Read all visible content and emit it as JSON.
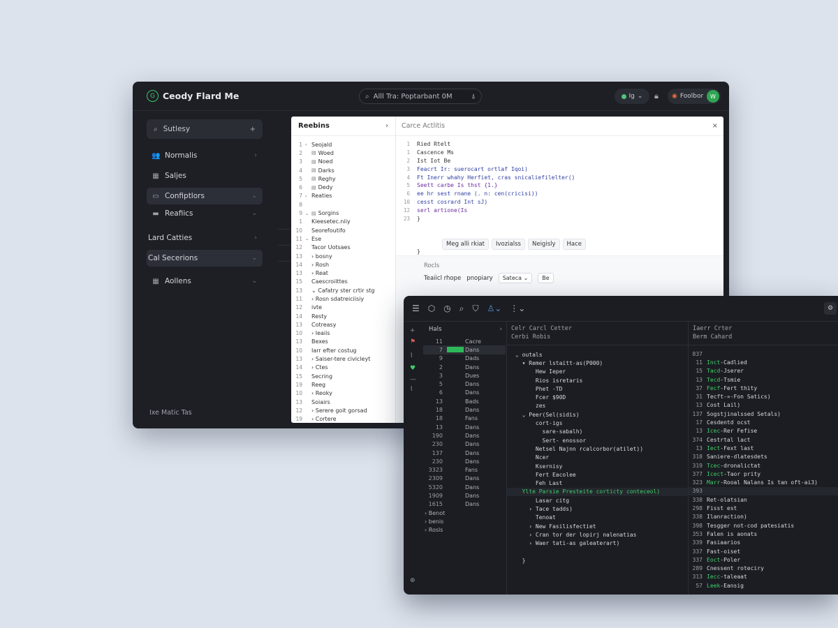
{
  "win1": {
    "brand": {
      "logo": "G",
      "name": "Ceody Flard Me"
    },
    "search": {
      "text": "Alll Tra: Poptarbant 0M"
    },
    "lang_label": "Ig",
    "user_name": "Foolbor",
    "user_avatar": "W",
    "sidebar": {
      "search_text": "Sutlesy",
      "items": [
        {
          "label": "Normalis",
          "icon": "users-icon",
          "glyph": "👥",
          "chev": "›",
          "active": false
        },
        {
          "label": "Saljes",
          "icon": "grid-icon",
          "glyph": "▦",
          "chev": "",
          "active": false
        },
        {
          "label": "Confiptlors",
          "icon": "folder-icon",
          "glyph": "▭",
          "chev": "⌄",
          "active": true
        },
        {
          "label": "Reafiics",
          "icon": "folder-icon",
          "glyph": "▬",
          "chev": "⌄",
          "active": false
        },
        {
          "label": "Lard Catties",
          "icon": "",
          "glyph": "",
          "chev": "›",
          "active": false
        },
        {
          "label": "Cal Secerions",
          "icon": "",
          "glyph": "",
          "chev": "⌄",
          "active": true
        },
        {
          "label": "Aollens",
          "icon": "grid-icon",
          "glyph": "▦",
          "chev": "⌄",
          "active": false
        }
      ],
      "footer": "Ixe Matic Tas"
    },
    "tree": {
      "title": "Reebins",
      "rows": [
        {
          "ln": "1",
          "arr": "›",
          "icon": "",
          "t": "Seojald"
        },
        {
          "ln": "2",
          "arr": "",
          "icon": "▤",
          "t": "Woed"
        },
        {
          "ln": "3",
          "arr": "",
          "icon": "▤",
          "t": "Noed"
        },
        {
          "ln": "4",
          "arr": "",
          "icon": "▤",
          "t": "Darks"
        },
        {
          "ln": "5",
          "arr": "",
          "icon": "▤",
          "t": "Reghy"
        },
        {
          "ln": "6",
          "arr": "",
          "icon": "▤",
          "t": "Dedy"
        },
        {
          "ln": "7",
          "arr": "›",
          "icon": "",
          "t": "Reaties"
        },
        {
          "ln": "8",
          "arr": "",
          "icon": "",
          "t": ""
        },
        {
          "ln": "9",
          "arr": "⌄",
          "icon": "▤",
          "t": "Sorgins"
        },
        {
          "ln": "1",
          "arr": "",
          "icon": "",
          "t": "Kieesetec.niiy"
        },
        {
          "ln": "10",
          "arr": "",
          "icon": "",
          "t": "Seorefoutifo"
        },
        {
          "ln": "11",
          "arr": "⌄",
          "icon": "",
          "t": "Ese"
        },
        {
          "ln": "12",
          "arr": "",
          "icon": "",
          "t": "Tacor Uotsaes"
        },
        {
          "ln": "13",
          "arr": "",
          "icon": "",
          "t": "› bosny"
        },
        {
          "ln": "14",
          "arr": "",
          "icon": "",
          "t": "› Rosh"
        },
        {
          "ln": "13",
          "arr": "",
          "icon": "",
          "t": "› Reat"
        },
        {
          "ln": "15",
          "arr": "",
          "icon": "",
          "t": "Caescroiittes"
        },
        {
          "ln": "13",
          "arr": "",
          "icon": "",
          "t": "⌄ Cafatry ster crtir stg"
        },
        {
          "ln": "11",
          "arr": "",
          "icon": "",
          "t": "› Rosn sdatreiciisiy"
        },
        {
          "ln": "12",
          "arr": "",
          "icon": "",
          "t": "ivte"
        },
        {
          "ln": "14",
          "arr": "",
          "icon": "",
          "t": "Resty"
        },
        {
          "ln": "13",
          "arr": "",
          "icon": "",
          "t": "Cotreasy"
        },
        {
          "ln": "10",
          "arr": "",
          "icon": "",
          "t": "› Ieaiis"
        },
        {
          "ln": "13",
          "arr": "",
          "icon": "",
          "t": "Bexes"
        },
        {
          "ln": "10",
          "arr": "",
          "icon": "",
          "t": "Iarr efter costug"
        },
        {
          "ln": "13",
          "arr": "",
          "icon": "",
          "t": "› Saiser-tere civicleyt"
        },
        {
          "ln": "14",
          "arr": "",
          "icon": "",
          "t": "› Ctes"
        },
        {
          "ln": "15",
          "arr": "",
          "icon": "",
          "t": "Secring"
        },
        {
          "ln": "19",
          "arr": "",
          "icon": "",
          "t": "Reeg"
        },
        {
          "ln": "10",
          "arr": "",
          "icon": "",
          "t": "› Reoky"
        },
        {
          "ln": "13",
          "arr": "",
          "icon": "",
          "t": "Soiairs"
        },
        {
          "ln": "12",
          "arr": "",
          "icon": "",
          "t": "› Serere goit gorsad"
        },
        {
          "ln": "19",
          "arr": "",
          "icon": "",
          "t": "› Cortere"
        },
        {
          "ln": "15",
          "arr": "",
          "icon": "",
          "t": "› Cetienrs"
        }
      ]
    },
    "editor": {
      "title": "Carce Actlitis",
      "code": [
        {
          "ln": "1",
          "t": "Ried Rtelt"
        },
        {
          "ln": "1",
          "t": "Cascence Ms"
        },
        {
          "ln": "2",
          "t": "Ist Iot Be"
        },
        {
          "ln": "3",
          "t": "Feacrt Ir: suerocart ortlaf Iqoi)"
        },
        {
          "ln": "4",
          "t": "Ft  Inerr whahy Herfiet, cras snicaliefilelter()"
        },
        {
          "ln": "5",
          "t": "  Seett carbe Is thst {1.}"
        },
        {
          "ln": "6",
          "t": "    ee hr sest rnane (. n: cen(cricisi))"
        },
        {
          "ln": "10",
          "t": "    cesst cosrard Int sJ)"
        },
        {
          "ln": "12",
          "t": "    serl artione(Is"
        },
        {
          "ln": "23",
          "t": "  }"
        },
        {
          "ln": "",
          "t": ""
        },
        {
          "ln": "",
          "t": ""
        },
        {
          "ln": "",
          "t": ""
        },
        {
          "ln": "",
          "t": "}"
        }
      ],
      "chips": [
        "Meg alli rkiat",
        "Ivozialss",
        "Neigisly",
        "Hace"
      ],
      "bottom_label": "Rocls",
      "bottom_text1": "Teaiicl rhope",
      "bottom_text2": "pnopiary",
      "bottom_select": "Sateca ⌄",
      "bottom_extra": "Be",
      "close": "×"
    }
  },
  "win2": {
    "list": {
      "title": "Hals",
      "rows": [
        {
          "n": "11",
          "bar": false,
          "v": "Cacre",
          "sel": false
        },
        {
          "n": "7",
          "bar": true,
          "v": "Dans",
          "sel": true
        },
        {
          "n": "9",
          "bar": false,
          "v": "Dads",
          "sel": false
        },
        {
          "n": "2",
          "bar": false,
          "v": "Dans",
          "sel": false
        },
        {
          "n": "3",
          "bar": false,
          "v": "Dues",
          "sel": false
        },
        {
          "n": "5",
          "bar": false,
          "v": "Dans",
          "sel": false
        },
        {
          "n": "6",
          "bar": false,
          "v": "Dans",
          "sel": false
        },
        {
          "n": "13",
          "bar": false,
          "v": "Bads",
          "sel": false
        },
        {
          "n": "18",
          "bar": false,
          "v": "Dans",
          "sel": false
        },
        {
          "n": "18",
          "bar": false,
          "v": "Fans",
          "sel": false
        },
        {
          "n": "13",
          "bar": false,
          "v": "Dans",
          "sel": false
        },
        {
          "n": "190",
          "bar": false,
          "v": "Dans",
          "sel": false
        },
        {
          "n": "230",
          "bar": false,
          "v": "Dans",
          "sel": false
        },
        {
          "n": "137",
          "bar": false,
          "v": "Dans",
          "sel": false
        },
        {
          "n": "230",
          "bar": false,
          "v": "Dans",
          "sel": false
        },
        {
          "n": "3323",
          "bar": false,
          "v": "Fans",
          "sel": false
        },
        {
          "n": "2309",
          "bar": false,
          "v": "Dans",
          "sel": false
        },
        {
          "n": "5320",
          "bar": false,
          "v": "Dans",
          "sel": false
        },
        {
          "n": "1909",
          "bar": false,
          "v": "Dans",
          "sel": false
        },
        {
          "n": "1615",
          "bar": false,
          "v": "Dans",
          "sel": false
        }
      ],
      "tree": [
        "› Benot",
        "› benis",
        "› Rosls"
      ]
    },
    "mid": {
      "head1": "Celr Carcl Cetter",
      "head2": "Cerbi Robis",
      "rows": [
        "⌄ outals",
        "  ▾ Remer lstaitt-as(P000)",
        "      Hew Ieper",
        "      Rios isretaris",
        "      Phet -TD",
        "      Fcer $90D",
        "      zes",
        "  ⌄ Peer(Sel(sidis)",
        "      cort-igs",
        "        sare-sabalh)",
        "        Sert- enossor",
        "      Netsel Najnn rcalcorbor(atilet))",
        "      Ncer",
        "      Ksernisy",
        "      Fert Eacolee",
        "      Feh Last",
        "  Ylte Parsie Presteite corticty conteceol)",
        "      Lasar citg",
        "    › Tace tadds)",
        "      Tenoat",
        "    › New Fasilisfectiet",
        "    › Cran tor der lopirj nalenatias",
        "    › Waer tati-as galeaterart)",
        "",
        "  }"
      ]
    },
    "right": {
      "head1": "Iaerr Crter",
      "head2": "Berm Cahard",
      "rows": [
        {
          "n": "837",
          "g": "",
          "t": ""
        },
        {
          "n": "11",
          "g": "Inct",
          "t": "-Cadlied"
        },
        {
          "n": "15",
          "g": "Tacd",
          "t": "-Jserer"
        },
        {
          "n": "13",
          "g": "Tecd",
          "t": "-Tsmie"
        },
        {
          "n": "37",
          "g": "Fecf",
          "t": "-Fert thity"
        },
        {
          "n": "31",
          "g": "",
          "t": "Tecft-»-Fon Satics)"
        },
        {
          "n": "13",
          "g": "",
          "t": "Cost Lail)"
        },
        {
          "n": "137",
          "g": "",
          "t": "Sogstjinalssed Setals)"
        },
        {
          "n": "17",
          "g": "",
          "t": "Cesdentd ocst"
        },
        {
          "n": "13",
          "g": "Icec",
          "t": "-Rer Fefise"
        },
        {
          "n": "374",
          "g": "",
          "t": "Cestrtal lact"
        },
        {
          "n": "13",
          "g": "Iect",
          "t": "-Fext last"
        },
        {
          "n": "318",
          "g": "",
          "t": "Saniere-dlatesdets"
        },
        {
          "n": "319",
          "g": "Tcec",
          "t": "-dronalictat"
        },
        {
          "n": "377",
          "g": "Icect",
          "t": "-Taor prity"
        },
        {
          "n": "323",
          "g": "Marr",
          "t": "-Rooal Nalans Is tan oft-ai3)"
        },
        {
          "n": "393",
          "g": "",
          "t": ""
        },
        {
          "n": "338",
          "g": "",
          "t": "Ret-olatsian"
        },
        {
          "n": "298",
          "g": "",
          "t": "Fisst est"
        },
        {
          "n": "338",
          "g": "",
          "t": "Ilanraction)"
        },
        {
          "n": "398",
          "g": "",
          "t": "Tesgger not-cod patesiatis"
        },
        {
          "n": "353",
          "g": "",
          "t": "Falen is aonats"
        },
        {
          "n": "339",
          "g": "",
          "t": "Fasiaarios"
        },
        {
          "n": "337",
          "g": "",
          "t": "Fast-oiset"
        },
        {
          "n": "337",
          "g": "Eoct",
          "t": "-Poler"
        },
        {
          "n": "289",
          "g": "",
          "t": "Cnessent roteciry"
        },
        {
          "n": "313",
          "g": "Iecc",
          "t": "-taleaat"
        },
        {
          "n": "57",
          "g": "Leek",
          "t": "-Eansig"
        }
      ]
    }
  },
  "colors": {
    "accent_green": "#3fcf6c",
    "window_bg": "#1d1f25",
    "page_bg": "#dde3ec"
  }
}
